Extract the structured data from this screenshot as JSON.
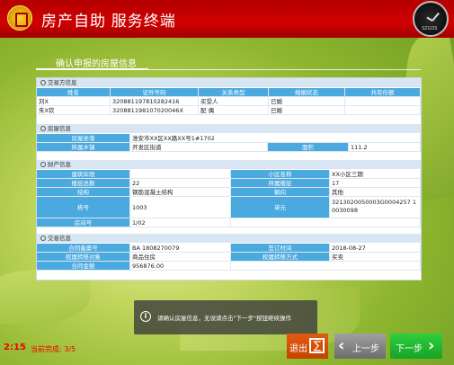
{
  "header": {
    "title": "房产自助 服务终端",
    "clock_brand": "SZGOS"
  },
  "page": {
    "title": "确认申报的房屋信息"
  },
  "parties": {
    "section_title": "交易方信息",
    "headers": [
      "姓名",
      "证件号码",
      "关系类型",
      "婚姻状态",
      "共有份额"
    ],
    "rows": [
      [
        "刘X",
        "320881197810282416",
        "买受人",
        "已婚",
        ""
      ],
      [
        "朱X钦",
        "320881198107020046X",
        "配 偶",
        "已婚",
        ""
      ]
    ]
  },
  "house": {
    "section_title": "房屋信息",
    "address_label": "房屋坐落",
    "address": "淮安市XX区XX路XX号1#1702",
    "town_label": "所属乡镇",
    "town": "开发区街道",
    "area_label": "面积",
    "area": "111.2"
  },
  "property": {
    "section_title": "财产信息",
    "rows": [
      [
        "建筑年限",
        "",
        "小区名称",
        "XX小区三期"
      ],
      [
        "楼层总数",
        "22",
        "所属楼层",
        "17"
      ],
      [
        "结构",
        "钢筋混凝土结构",
        "朝向",
        "其他"
      ],
      [
        "栋号",
        "1003",
        "单元",
        "3213020050003G0004257 10030098"
      ],
      [
        "房间号",
        "1/02",
        "",
        ""
      ]
    ]
  },
  "contract": {
    "section_title": "交易信息",
    "rows": [
      [
        "合同备案号",
        "BA 1808270079",
        "签订时间",
        "2018-08-27"
      ],
      [
        "权属转移对象",
        "商品住房",
        "权属转移方式",
        "买卖"
      ],
      [
        "合同金额",
        "956876.00",
        "",
        ""
      ]
    ]
  },
  "notice": {
    "text": "请确认房屋信息，无误请点击\"下一步\"按钮继续操作"
  },
  "footer": {
    "countdown": "2:15",
    "progress": "当前完成: 3/5",
    "exit_label": "退出",
    "prev_label": "上一步",
    "next_label": "下一步"
  }
}
